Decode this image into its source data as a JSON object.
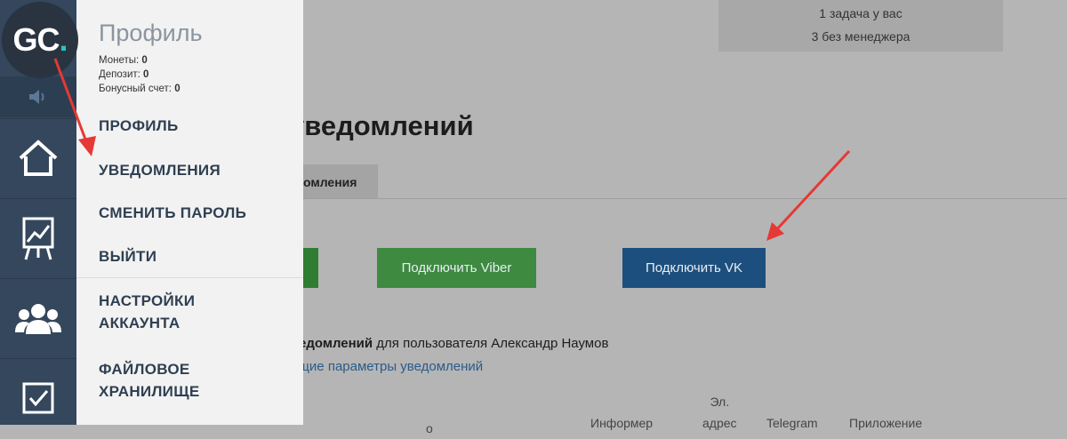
{
  "logo": {
    "text": "GC",
    "dot": "."
  },
  "menu": {
    "title": "Профиль",
    "stats": [
      {
        "label": "Монеты:",
        "value": "0"
      },
      {
        "label": "Депозит:",
        "value": "0"
      },
      {
        "label": "Бонусный счет:",
        "value": "0"
      }
    ],
    "links": {
      "profile": "ПРОФИЛЬ",
      "notifications": "УВЕДОМЛЕНИЯ",
      "change_password": "СМЕНИТЬ ПАРОЛЬ",
      "logout": "ВЫЙТИ",
      "account_settings_1": "НАСТРОЙКИ",
      "account_settings_2": "АККАУНТА",
      "file_storage_1": "ФАЙЛОВОЕ",
      "file_storage_2": "ХРАНИЛИЩЕ"
    }
  },
  "sidebar": {
    "icons": [
      "speaker-icon",
      "home-icon",
      "chart-icon",
      "users-icon",
      "checkbox-icon"
    ]
  },
  "top_box": {
    "line1": "1 задача у вас",
    "line2": "3 без менеджера"
  },
  "main": {
    "heading": "уведомлений",
    "active_tab": "омления",
    "buttons": {
      "viber": "Подключить Viber",
      "vk": "Подключить VK"
    },
    "info_bold": "ведомлений",
    "info_rest": " для пользователя Александр Наумов",
    "info_link": "бщие параметры уведомлений",
    "columns": {
      "col_o": "о",
      "informer": "Информер",
      "email_1": "Эл.",
      "email_2": "адрес",
      "telegram": "Telegram",
      "app": "Приложение"
    }
  },
  "colors": {
    "sidebar": "#34475c",
    "menu_bg": "#f2f2f2",
    "overlay_bg": "#b5b5b5",
    "arrow": "#e53935",
    "vk_button": "#1d4f7e",
    "viber_button": "#3e8a40"
  }
}
